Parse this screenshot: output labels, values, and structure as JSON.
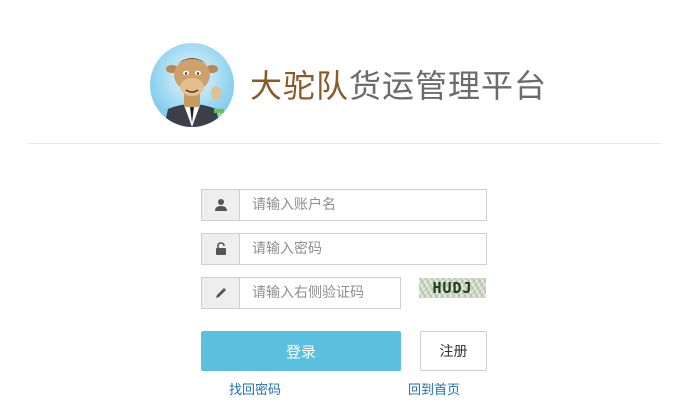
{
  "header": {
    "title_brand": "大驼队",
    "title_rest": "货运管理平台"
  },
  "login_form": {
    "username_placeholder": "请输入账户名",
    "password_placeholder": "请输入密码",
    "captcha_placeholder": "请输入右侧验证码",
    "captcha_text": "HUDJ",
    "login_label": "登录",
    "register_label": "注册",
    "forgot_password_link": "找回密码",
    "home_link": "回到首页"
  },
  "icons": {
    "username": "user-icon",
    "password": "unlock-icon",
    "captcha": "pencil-icon",
    "logo": "camel-mascot-logo"
  },
  "colors": {
    "brand": "#8b5a2b",
    "title_gray": "#6b6b6b",
    "login_button": "#5bc0de",
    "link": "#1f6fb2"
  }
}
